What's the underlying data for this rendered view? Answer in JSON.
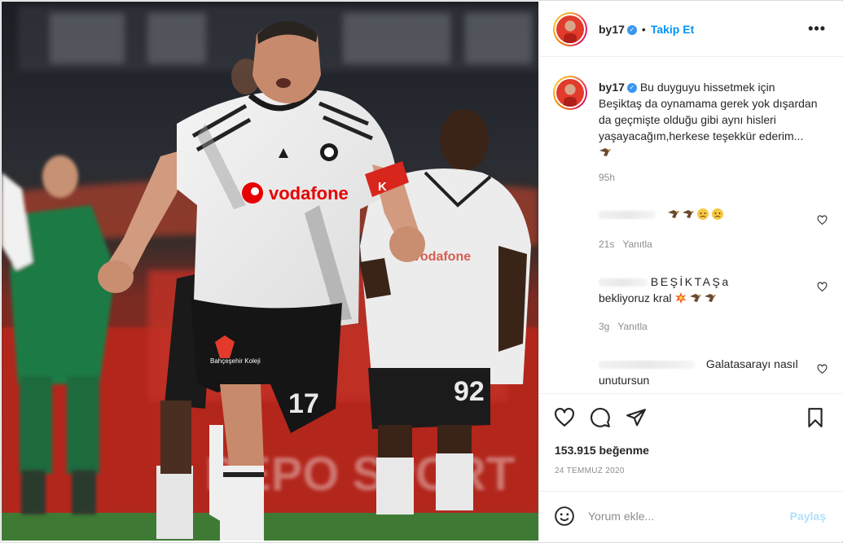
{
  "post": {
    "username": "by17",
    "follow_label": "Takip Et",
    "separator": "•",
    "more_label": "•••",
    "verified_mark": "✓"
  },
  "caption": {
    "username": "by17",
    "text": "Bu duyguyu hissetmek için Beşiktaş da oynamama gerek yok dışardan da geçmişte olduğu gibi aynı hisleri yaşayacağım,herkese teşekkür ederim...",
    "time": "95h"
  },
  "comments": [
    {
      "text": "",
      "time": "21s",
      "reply_label": "Yanıtla",
      "emojis": [
        "eagle-emoji",
        "eagle-emoji",
        "sad-face-emoji",
        "sad-face-emoji"
      ]
    },
    {
      "text": "BEŞİKTAŞa",
      "text2": "bekliyoruz kral",
      "time": "3g",
      "reply_label": "Yanıtla",
      "emojis": [
        "collision-emoji",
        "eagle-emoji",
        "eagle-emoji"
      ]
    },
    {
      "text": "Galatasarayı nasıl",
      "text2": "unutursun"
    }
  ],
  "stats": {
    "likes": "153.915 beğenme",
    "date": "24 TEMMUZ 2020"
  },
  "add_comment": {
    "placeholder": "Yorum ekle...",
    "post_label": "Paylaş"
  },
  "photo": {
    "sponsor_text": "vodafone",
    "jersey_number_main": "17",
    "jersey_number_right": "92",
    "captain_band": "K",
    "shorts_sponsor": "Bahçeşehir Koleji",
    "board_text": "DEPO SPORT"
  },
  "colors": {
    "accent": "#0095f6",
    "verified": "#3897f0",
    "muted": "#8e8e8e",
    "text": "#262626",
    "pitch_green": "#2f7a3a",
    "opponent_green": "#1f7a43"
  },
  "icons": [
    "heart-icon",
    "comment-icon",
    "share-icon",
    "bookmark-icon",
    "smile-icon",
    "more-icon",
    "verified-icon"
  ]
}
